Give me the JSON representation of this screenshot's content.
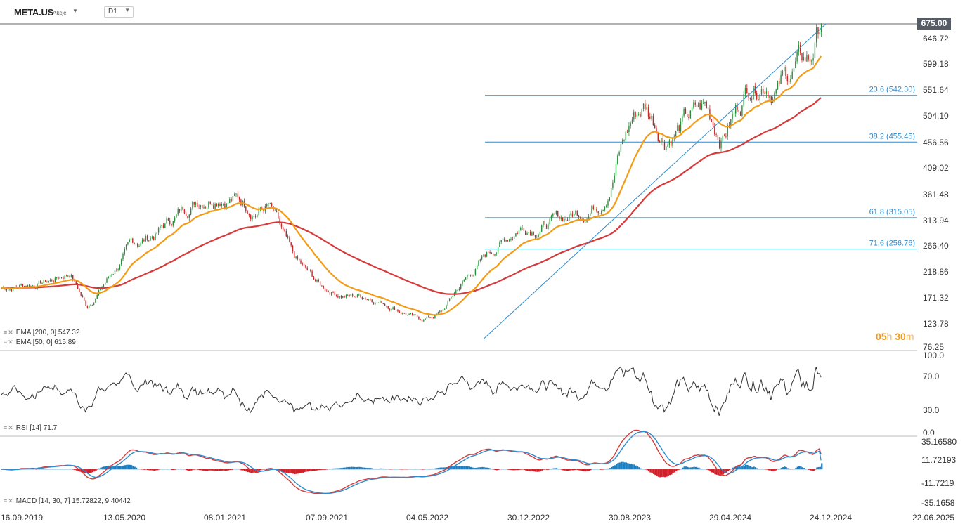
{
  "header": {
    "symbol": "META.US",
    "instrument_type": "Akcje",
    "timeframe": "D1"
  },
  "current_price": "675.00",
  "price_axis": [
    "646.72",
    "599.18",
    "551.64",
    "504.10",
    "456.56",
    "409.02",
    "361.48",
    "313.94",
    "266.40",
    "218.86",
    "171.32",
    "123.78",
    "76.25"
  ],
  "rsi_axis": [
    "100.0",
    "70.0",
    "30.0",
    "0.0"
  ],
  "macd_axis": [
    "35.16580",
    "11.72193",
    "-11.7219",
    "-35.1658"
  ],
  "date_axis": [
    "16.09.2019",
    "13.05.2020",
    "08.01.2021",
    "07.09.2021",
    "04.05.2022",
    "30.12.2022",
    "30.08.2023",
    "29.04.2024",
    "24.12.2024",
    "22.06.2025"
  ],
  "fib_levels": [
    {
      "label": "23.6 (542.30)",
      "value": 542.3
    },
    {
      "label": "38.2 (455.45)",
      "value": 455.45
    },
    {
      "label": "61.8 (315.05)",
      "value": 315.05
    },
    {
      "label": "71.6 (256.76)",
      "value": 256.76
    }
  ],
  "indicators": {
    "ema200": "EMA [200,  0]  547.32",
    "ema50": "EMA [50,  0]  615.89",
    "rsi": "RSI [14]  71.7",
    "macd": "MACD [14, 30, 7]  15.72822,   9.40442"
  },
  "timer": {
    "h": "05",
    "h_unit": "h",
    "m": "30",
    "m_unit": "m"
  },
  "colors": {
    "ema50": "#f29b16",
    "ema200": "#d63a3a",
    "fib": "#2c8ccf",
    "trendline": "#2c8ccf",
    "up": "#2b8c3e",
    "down": "#c62828",
    "rsi": "#333333",
    "macd_line": "#d63a3a",
    "signal_line": "#2c8ccf",
    "hist_pos": "#1e7fc0",
    "hist_neg": "#d0202a"
  },
  "chart_data": {
    "type": "line",
    "price_key_points": [
      {
        "date": "16.09.2019",
        "close": 185
      },
      {
        "date": "13.05.2020",
        "close": 230
      },
      {
        "date": "08.01.2021",
        "close": 260
      },
      {
        "date": "07.09.2021",
        "close": 375
      },
      {
        "date": "04.05.2022",
        "close": 200
      },
      {
        "date": "03.11.2022",
        "close": 90
      },
      {
        "date": "30.12.2022",
        "close": 120
      },
      {
        "date": "30.08.2023",
        "close": 295
      },
      {
        "date": "29.04.2024",
        "close": 440
      },
      {
        "date": "24.12.2024",
        "close": 600
      },
      {
        "date": "14.02.2025",
        "close": 675
      }
    ],
    "ema50_last": 615.89,
    "ema200_last": 547.32,
    "rsi_last": 71.7,
    "macd_last": 15.72822,
    "signal_last": 9.40442
  }
}
